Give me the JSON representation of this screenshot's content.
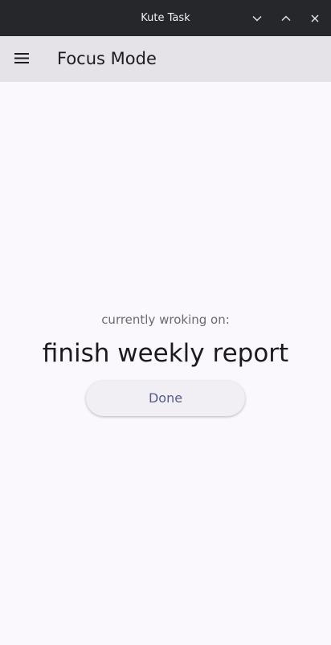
{
  "window": {
    "title": "Kute Task",
    "controls": {
      "minimize_icon": "chevron-down-icon",
      "maximize_icon": "chevron-up-icon",
      "close_icon": "close-icon"
    }
  },
  "appbar": {
    "menu_icon": "menu-icon",
    "title": "Focus Mode"
  },
  "focus": {
    "caption": "currently wroking on:",
    "task_name": "finish weekly report",
    "done_label": "Done"
  },
  "colors": {
    "titlebar_bg": "#25272b",
    "appbar_bg": "#e5e2e8",
    "page_bg": "#fbf8fd",
    "button_bg": "#f2eff4",
    "button_text": "#535b8e"
  }
}
